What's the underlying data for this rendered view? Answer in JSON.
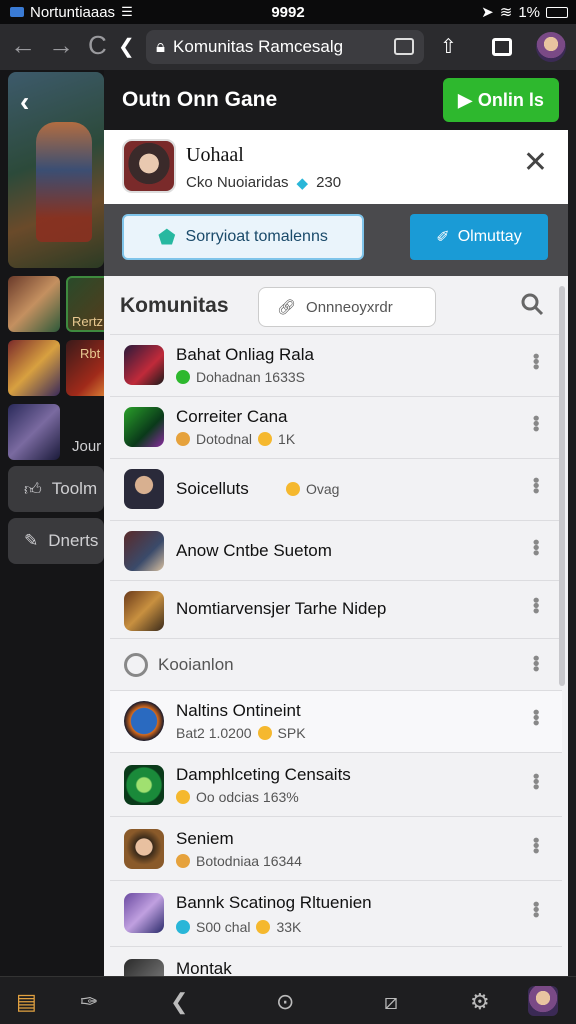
{
  "status_bar": {
    "app": "Nortuntiaaas",
    "time": "9992",
    "battery": "1%"
  },
  "browser": {
    "url": "Komunitas Ramcesalg"
  },
  "left": {
    "toolbar_label": "Toolm",
    "compose_label": "Dnerts",
    "journal_label": "Jour",
    "thumb_text_1": "Rertz",
    "thumb_text_2": "Rbt"
  },
  "header": {
    "title": "Outn Onn Gane",
    "online_btn": "Onlin ls"
  },
  "user": {
    "name": "Uohaal",
    "sub_label": "Cko Nuoiaridas",
    "sub_value": "230"
  },
  "actions": {
    "primary": "Sorryioat tomalenns",
    "secondary": "Olmuttay"
  },
  "panel": {
    "title": "Komunitas",
    "search_placeholder": "Onnneoyxrdr",
    "items_top": [
      {
        "title": "Bahat Onliag Rala",
        "sub": "Dohadnan 1633S",
        "badge_color": "#2eb82e"
      },
      {
        "title": "Correiter Cana",
        "sub": "Dotodnal",
        "count": "1K",
        "badge_color": "#e6a23c"
      },
      {
        "title": "Soicelluts",
        "sub": "Ovag",
        "badge_color": "#f5b82e"
      },
      {
        "title": "Anow Cntbe Suetom"
      },
      {
        "title": "Nomtiarvensjer Tarhe Nidep"
      }
    ],
    "section_label": "Kooianlon",
    "items_bottom": [
      {
        "title": "Naltins Ontineint",
        "sub": "Bat2 1.0200",
        "count": "SPK",
        "badge_color": "#f5b82e"
      },
      {
        "title": "Damphlceting Censaits",
        "sub": "Oo odcias 163%",
        "badge_color": "#f5b82e"
      },
      {
        "title": "Seniem",
        "sub": "Botodniaa 16344",
        "badge_color": "#e6a23c"
      },
      {
        "title": "Bannk Scatinog Rltuenien",
        "sub": "S00 chal",
        "count": "33K",
        "badge_color": "#29b6d8"
      },
      {
        "title": "Montak"
      }
    ]
  }
}
